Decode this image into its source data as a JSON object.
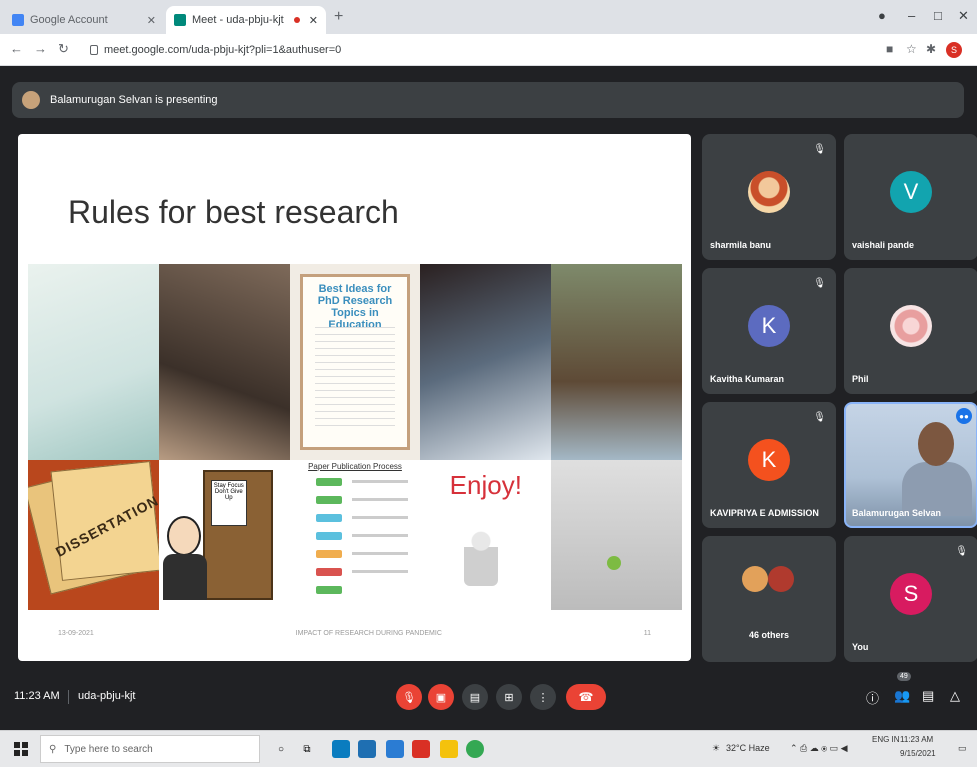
{
  "browser": {
    "tabs": [
      {
        "title": "Google Account",
        "active": false
      },
      {
        "title": "Meet - uda-pbju-kjt",
        "active": true
      }
    ],
    "url": "meet.google.com/uda-pbju-kjt?pli=1&authuser=0"
  },
  "meet": {
    "presenting_banner": "Balamurugan Selvan is presenting",
    "slide": {
      "title": "Rules for best research",
      "poster_title": "Best Ideas for PhD Research Topics in Education",
      "paper_label": "DISSERTATION",
      "cartoon_sign": "Stay Focus Don't Give Up",
      "process_title": "Paper Publication Process",
      "enjoy_text": "Enjoy!",
      "footer_date": "13-09-2021",
      "footer_center": "IMPACT OF RESEARCH DURING PANDEMIC",
      "footer_page": "11"
    },
    "participants": [
      {
        "name": "sharmila banu",
        "type": "photo",
        "muted": true
      },
      {
        "name": "vaishali pande",
        "type": "initial",
        "initial": "V",
        "color": "#12a4af",
        "muted": false
      },
      {
        "name": "Kavitha Kumaran",
        "type": "initial",
        "initial": "K",
        "color": "#5c6bc0",
        "muted": true
      },
      {
        "name": "Phil",
        "type": "photo",
        "muted": false
      },
      {
        "name": "KAVIPRIYA E ADMISSION",
        "type": "initial",
        "initial": "K",
        "color": "#f4511e",
        "muted": true
      },
      {
        "name": "Balamurugan Selvan",
        "type": "video",
        "muted": false
      },
      {
        "name": "46 others",
        "type": "group",
        "muted": false
      },
      {
        "name": "You",
        "type": "initial",
        "initial": "S",
        "color": "#d81b60",
        "muted": true
      }
    ],
    "controls": {
      "time": "11:23 AM",
      "meeting_code": "uda-pbju-kjt",
      "participant_badge": "49"
    }
  },
  "taskbar": {
    "search_placeholder": "Type here to search",
    "weather": "32°C Haze",
    "lang": "ENG IN",
    "clock_time": "11:23 AM",
    "clock_date": "9/15/2021"
  }
}
